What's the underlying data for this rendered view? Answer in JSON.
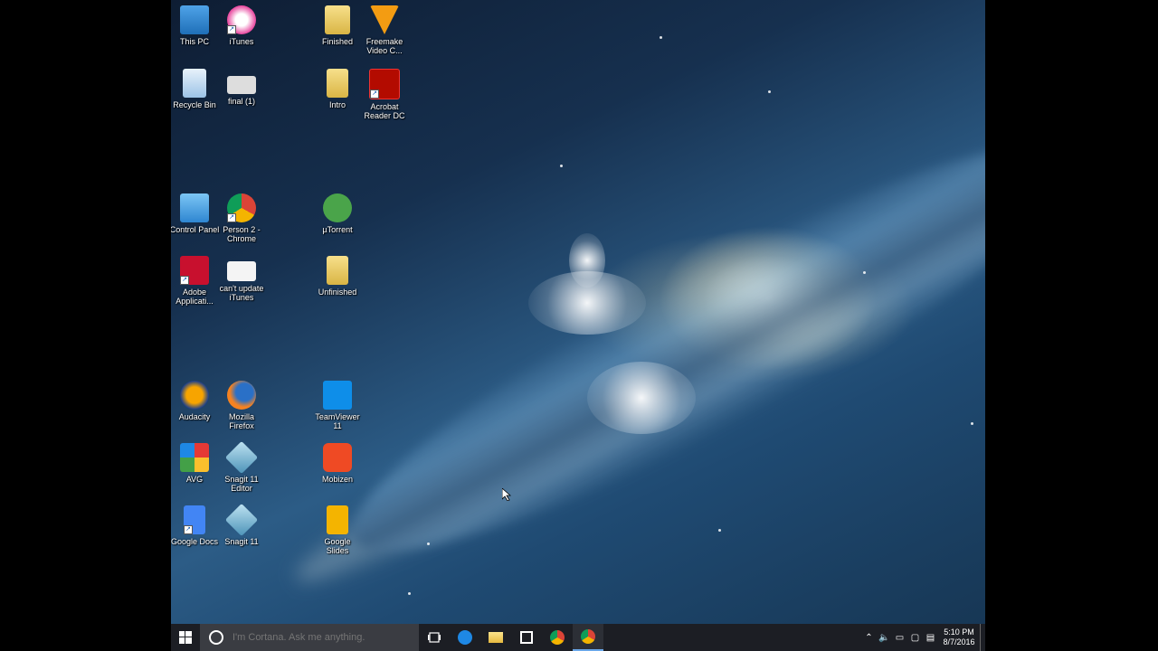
{
  "desktop": {
    "icons": [
      {
        "label": "This PC",
        "icon": "this-pc-icon"
      },
      {
        "label": "iTunes",
        "icon": "itunes-icon"
      },
      {
        "label": "Finished",
        "icon": "folder-icon"
      },
      {
        "label": "Freemake Video C...",
        "icon": "freemake-icon"
      },
      {
        "label": "Recycle Bin",
        "icon": "recycle-bin-icon"
      },
      {
        "label": "final (1)",
        "icon": "image-file-icon"
      },
      {
        "label": "Intro",
        "icon": "folder-icon"
      },
      {
        "label": "Acrobat Reader DC",
        "icon": "acrobat-icon"
      },
      {
        "label": "Control Panel",
        "icon": "control-panel-icon"
      },
      {
        "label": "Person 2 - Chrome",
        "icon": "chrome-icon"
      },
      {
        "label": "µTorrent",
        "icon": "utorrent-icon"
      },
      {
        "label": "Adobe Applicati...",
        "icon": "adobe-icon"
      },
      {
        "label": "can't update iTunes",
        "icon": "image-file-icon"
      },
      {
        "label": "Unfinished",
        "icon": "folder-icon"
      },
      {
        "label": "Audacity",
        "icon": "audacity-icon"
      },
      {
        "label": "Mozilla Firefox",
        "icon": "firefox-icon"
      },
      {
        "label": "TeamViewer 11",
        "icon": "teamviewer-icon"
      },
      {
        "label": "AVG",
        "icon": "avg-icon"
      },
      {
        "label": "Snagit 11 Editor",
        "icon": "snagit-icon"
      },
      {
        "label": "Mobizen",
        "icon": "mobizen-icon"
      },
      {
        "label": "Google Docs",
        "icon": "google-docs-icon"
      },
      {
        "label": "Snagit 11",
        "icon": "snagit-icon"
      },
      {
        "label": "Google Slides",
        "icon": "google-slides-icon"
      }
    ]
  },
  "taskbar": {
    "search_placeholder": "I'm Cortana. Ask me anything.",
    "apps": [
      "task-view-icon",
      "edge-icon",
      "file-explorer-icon",
      "store-icon",
      "chrome-icon",
      "chrome-person-icon"
    ],
    "clock_time": "5:10 PM",
    "clock_date": "8/7/2016"
  },
  "colors": {
    "taskbar_bg": "#1c1e24",
    "search_bg": "#3a3c42",
    "accent": "#6aa7e8"
  }
}
